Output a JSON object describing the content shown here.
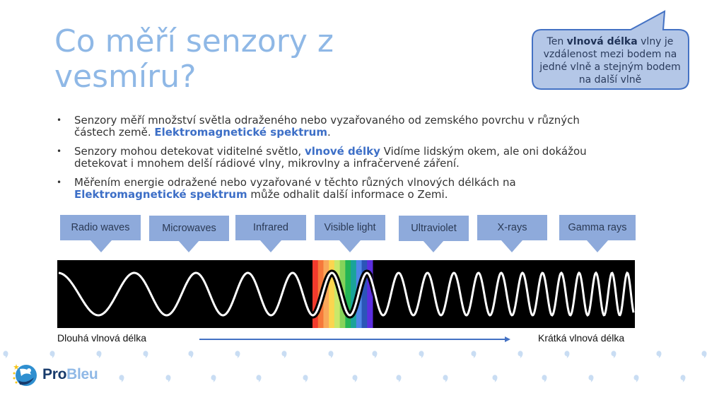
{
  "slide": {
    "title": "Co měří senzory z vesmíru?",
    "callout": {
      "prefix": "Ten ",
      "bold": "vlnová délka",
      "suffix": " vlny je vzdálenost mezi bodem na jedné vlně a stejným bodem na další vlně"
    },
    "bullets": [
      {
        "parts": [
          {
            "text": "Senzory měří množství světla odraženého nebo vyzařovaného od zemského povrchu v různých částech země. ",
            "highlight": false
          },
          {
            "text": "Elektromagnetické spektrum",
            "highlight": true
          },
          {
            "text": ".",
            "highlight": false
          }
        ]
      },
      {
        "parts": [
          {
            "text": "Senzory mohou detekovat viditelné světlo, ",
            "highlight": false
          },
          {
            "text": "vlnové délky",
            "highlight": true
          },
          {
            "text": " Vidíme lidským okem, ale oni dokážou detekovat i mnohem delší rádiové vlny, mikrovlny a infračervené záření.",
            "highlight": false
          }
        ]
      },
      {
        "parts": [
          {
            "text": "Měřením energie odražené nebo vyzařované v těchto různých vlnových délkách na ",
            "highlight": false
          },
          {
            "text": "Elektromagnetické spektrum",
            "highlight": true
          },
          {
            "text": " může odhalit další informace o Zemi.",
            "highlight": false
          }
        ]
      }
    ],
    "bullet_glyph": "•",
    "bands": [
      {
        "label": "Radio waves"
      },
      {
        "label": "Microwaves"
      },
      {
        "label": "Infrared"
      },
      {
        "label": "Visible light"
      },
      {
        "label": "Ultraviolet"
      },
      {
        "label": "X-rays"
      },
      {
        "label": "Gamma rays"
      }
    ],
    "visible_colors": [
      "#f23a2c",
      "#f6783a",
      "#f9a85a",
      "#fbd54f",
      "#c9e86a",
      "#86d35a",
      "#23b556",
      "#1aa39a",
      "#4f86e8",
      "#2b55b8",
      "#5b2ee0"
    ],
    "axis": {
      "long_label": "Dlouhá vlnová délka",
      "short_label": "Krátká vlnová délka"
    },
    "logo": {
      "pro": "Pro",
      "bleu": "Bleu"
    },
    "colors": {
      "title": "#8fb8e6",
      "accent": "#3d6fc7",
      "band_box": "#8eaadb",
      "callout_fill": "#b4c7e7",
      "callout_border": "#4472c4",
      "arrow": "#4472c4",
      "dot": "#c9ddf3"
    }
  }
}
